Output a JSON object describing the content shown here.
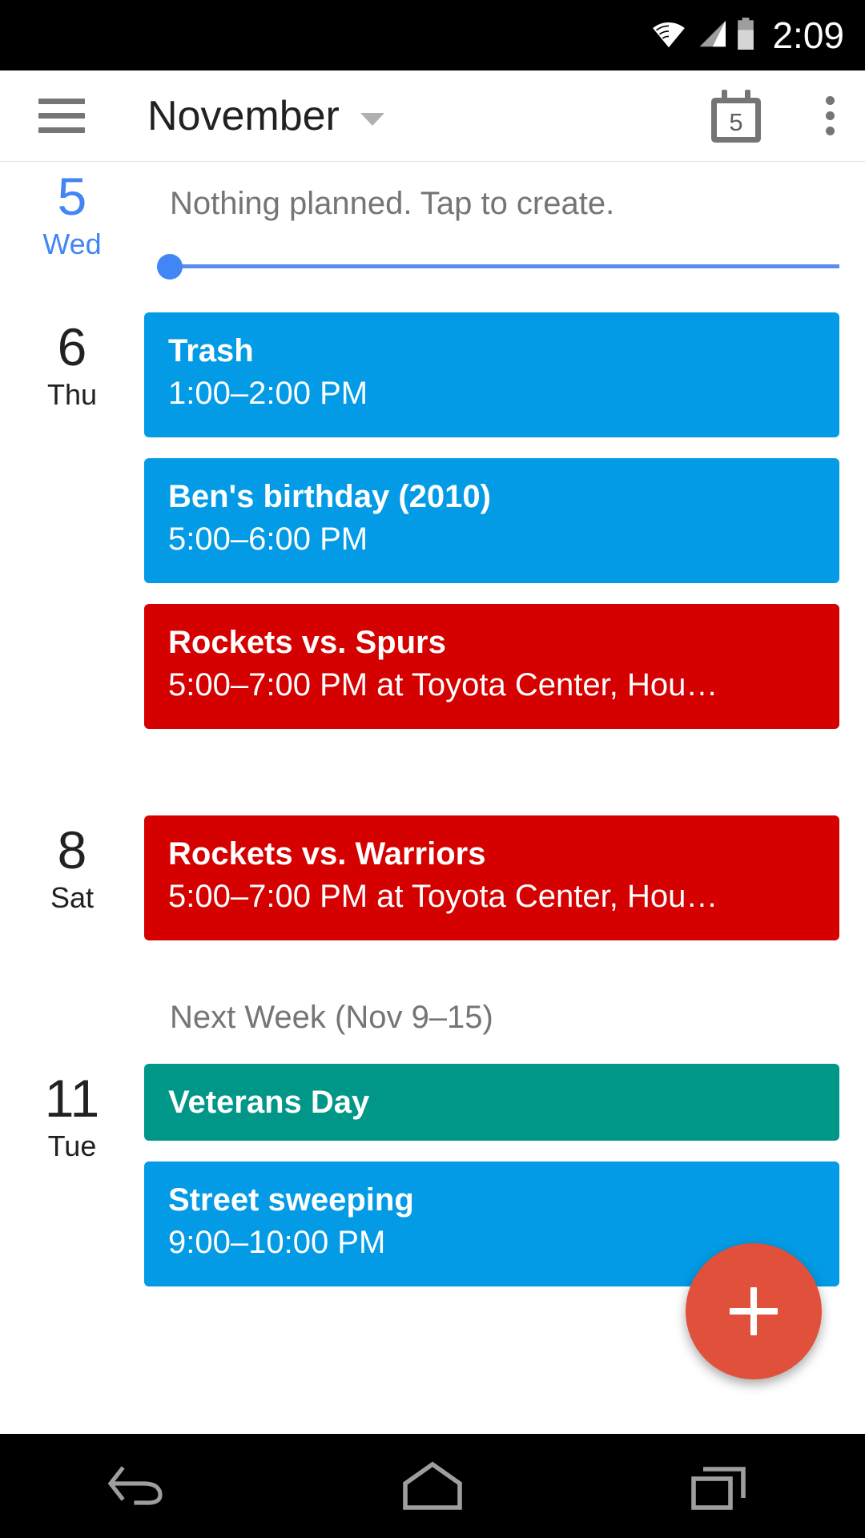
{
  "status_bar": {
    "time": "2:09",
    "icons": [
      "wifi-icon",
      "cellular-signal-icon",
      "battery-icon"
    ]
  },
  "app_bar": {
    "menu_icon": "hamburger-menu-icon",
    "title": "November",
    "dropdown_icon": "chevron-down-icon",
    "today_icon": "calendar-today-icon",
    "today_day": "5",
    "overflow_icon": "overflow-menu-icon"
  },
  "agenda": {
    "days": [
      {
        "num": "5",
        "dow": "Wed",
        "today": true,
        "empty_text": "Nothing planned. Tap to create.",
        "has_time_slider": true,
        "events": []
      },
      {
        "num": "6",
        "dow": "Thu",
        "today": false,
        "events": [
          {
            "title": "Trash",
            "sub": "1:00–2:00 PM",
            "color": "#039BE5",
            "allday": false
          },
          {
            "title": "Ben's birthday (2010)",
            "sub": "5:00–6:00 PM",
            "color": "#039BE5",
            "allday": false
          },
          {
            "title": "Rockets vs. Spurs",
            "sub": "5:00–7:00 PM at Toyota Center, Hou…",
            "color": "#D50000",
            "allday": false
          }
        ]
      },
      {
        "num": "8",
        "dow": "Sat",
        "today": false,
        "events": [
          {
            "title": "Rockets vs. Warriors",
            "sub": "5:00–7:00 PM at Toyota Center, Hou…",
            "color": "#D50000",
            "allday": false
          }
        ]
      }
    ],
    "section_header": "Next Week (Nov 9–15)",
    "next_week_days": [
      {
        "num": "11",
        "dow": "Tue",
        "today": false,
        "events": [
          {
            "title": "Veterans Day",
            "sub": "",
            "color": "#009688",
            "allday": true
          },
          {
            "title": "Street sweeping",
            "sub": "9:00–10:00 PM",
            "color": "#039BE5",
            "allday": false
          }
        ]
      }
    ]
  },
  "fab": {
    "label": "+",
    "name": "create-event-fab",
    "color": "#E0503B"
  },
  "nav_bar": {
    "back_label": "back-icon",
    "home_label": "home-icon",
    "recents_label": "recents-icon"
  },
  "colors": {
    "accent_blue": "#039BE5",
    "today_blue": "#4285F4",
    "event_red": "#D50000",
    "event_teal": "#009688",
    "fab_red": "#E0503B"
  }
}
